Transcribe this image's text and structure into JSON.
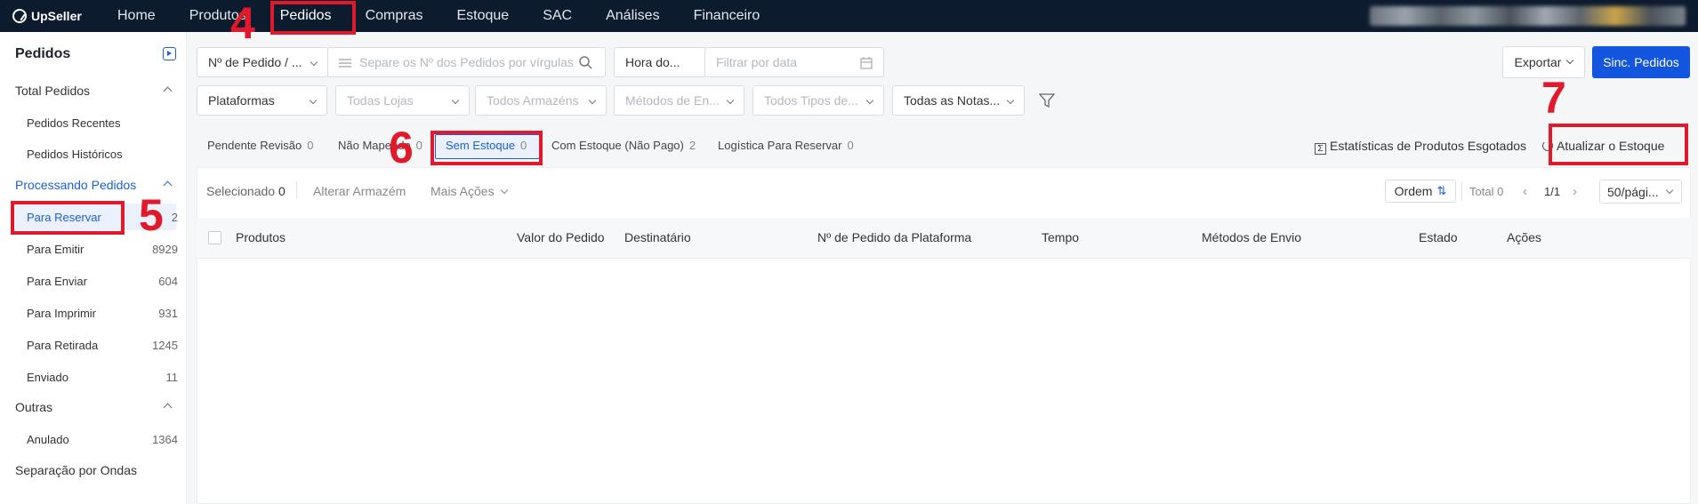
{
  "topnav": {
    "logo": "UpSeller",
    "items": [
      "Home",
      "Produtos",
      "Pedidos",
      "Compras",
      "Estoque",
      "SAC",
      "Análises",
      "Financeiro"
    ]
  },
  "sidebar": {
    "title": "Pedidos",
    "total_pedidos": "Total Pedidos",
    "pedidos_recentes": "Pedidos Recentes",
    "pedidos_historicos": "Pedidos Históricos",
    "processando": "Processando Pedidos",
    "items": [
      {
        "label": "Para Reservar",
        "count": "2"
      },
      {
        "label": "Para Emitir",
        "count": "8929"
      },
      {
        "label": "Para Enviar",
        "count": "604"
      },
      {
        "label": "Para Imprimir",
        "count": "931"
      },
      {
        "label": "Para Retirada",
        "count": "1245"
      },
      {
        "label": "Enviado",
        "count": "11"
      }
    ],
    "outras": "Outras",
    "anulado": {
      "label": "Anulado",
      "count": "1364"
    },
    "separacao": "Separação por Ondas"
  },
  "filters": {
    "order_type": "Nº de Pedido / ...",
    "search_placeholder": "Separe os Nº dos Pedidos por vírgulas",
    "hora": "Hora do...",
    "date_placeholder": "Filtrar por data",
    "plataformas": "Plataformas",
    "lojas": "Todas Lojas",
    "armazens": "Todos Armazéns",
    "metodos": "Métodos de En...",
    "tipos": "Todos Tipos de...",
    "notas": "Todas as Notas..."
  },
  "actions": {
    "exportar": "Exportar",
    "sinc": "Sinc. Pedidos",
    "estatisticas": "Estatísticas de Produtos Esgotados",
    "atualizar": "Atualizar o Estoque"
  },
  "tabs": [
    {
      "label": "Pendente Revisão",
      "count": "0"
    },
    {
      "label": "Não Mapeado",
      "count": "0"
    },
    {
      "label": "Sem Estoque",
      "count": "0"
    },
    {
      "label": "Com Estoque (Não Pago)",
      "count": "2"
    },
    {
      "label": "Logística Para Reservar",
      "count": "0"
    }
  ],
  "toolbar": {
    "selecionado": "Selecionado",
    "selecionado_count": "0",
    "alterar": "Alterar Armazém",
    "mais": "Mais Ações",
    "ordem": "Ordem",
    "total": "Total 0",
    "page": "1/1",
    "per_page": "50/pági..."
  },
  "columns": [
    "Produtos",
    "Valor do Pedido",
    "Destinatário",
    "Nº de Pedido da Plataforma",
    "Tempo",
    "Métodos de Envio",
    "Estado",
    "Ações"
  ],
  "annotations": [
    "4",
    "5",
    "6",
    "7"
  ],
  "colors": {
    "nav_bg": "#0d1b2e",
    "accent": "#1d5fd6",
    "annotation": "#e0192b"
  }
}
